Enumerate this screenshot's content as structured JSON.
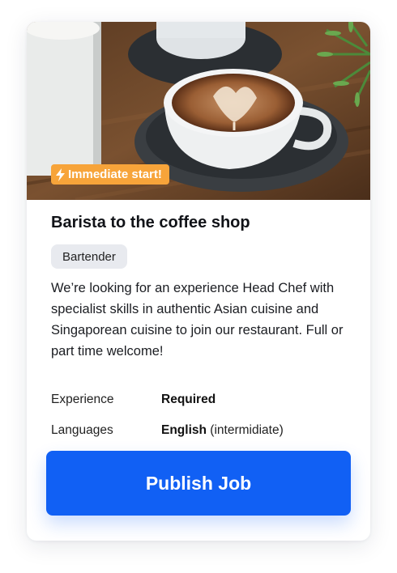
{
  "job": {
    "badge": "Immediate start!",
    "title": "Barista to the coffee shop",
    "tag": "Bartender",
    "description": "We’re looking for an experience Head Chef with specialist skills in authentic Asian cuisine and Singaporean cuisine to join our restaurant. Full or part time welcome!",
    "details": [
      {
        "label": "Experience",
        "value": "Required",
        "note": ""
      },
      {
        "label": "Languages",
        "value": "English",
        "note": "(intermidiate)"
      }
    ]
  },
  "actions": {
    "publish_label": "Publish Job"
  },
  "colors": {
    "accent": "#1160f4",
    "badge": "#f7a43a",
    "tag_bg": "#e8eaef"
  },
  "icons": {
    "badge_icon": "lightning-bolt-icon"
  }
}
